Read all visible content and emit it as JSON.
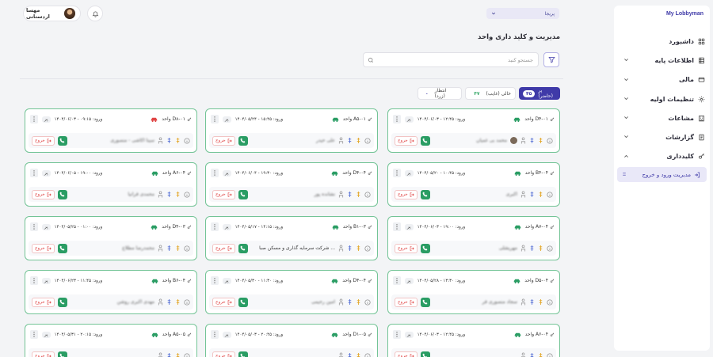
{
  "sidebar": {
    "brand": "My Lobbyman",
    "items": [
      {
        "label": "داشبورد",
        "icon": "dashboard-icon",
        "chevron": false
      },
      {
        "label": "اطلاعات پایه",
        "icon": "table-icon",
        "chevron": true
      },
      {
        "label": "مالی",
        "icon": "wallet-icon",
        "chevron": true
      },
      {
        "label": "تنظیمات اولیه",
        "icon": "gear-icon",
        "chevron": true
      },
      {
        "label": "مشاعات",
        "icon": "building-icon",
        "chevron": true
      },
      {
        "label": "گزارشات",
        "icon": "report-icon",
        "chevron": true
      },
      {
        "label": "کلیدداری",
        "icon": "key-icon",
        "chevron": true,
        "expanded": true
      }
    ],
    "subitem": {
      "label": "مدیریت ورود و خروج",
      "icon": "login-icon"
    }
  },
  "header": {
    "user_name": "مهسا اردستانی",
    "site_selector": "پریجا"
  },
  "main": {
    "title": "مدیریت و کلید داری واحد",
    "search_placeholder": "جستجو کنید",
    "tabs": {
      "full": {
        "label": "پر (حاضر)",
        "count": "۴۵"
      },
      "empty": {
        "label": "خالی (غایب)",
        "count": "۴۷"
      },
      "wait": {
        "label": "انتظار (زرد)",
        "count": "۰"
      }
    },
    "status_label": "پر",
    "exit_label": "خروج",
    "entry_prefix": "ورود:"
  },
  "cards": [
    {
      "unit": "واحد D۴-۰۱",
      "entry": "ورود: ۱۲:۴۵ - ۱۴۰۴/۰۶/۰۳",
      "person": "محمد بی غمیان",
      "blur": true,
      "avatar": true
    },
    {
      "unit": "واحد A۵-۰۱",
      "entry": "ورود: ۱۵:۴۵ - ۱۴۰۴/۰۵/۲۴",
      "person": "علی حیدر",
      "blur": true
    },
    {
      "unit": "واحد D۸-۰۱",
      "entry": "ورود: ۰۹:۱۵ - ۱۴۰۴/۰۶/۰۳",
      "person": "سینا اکاشی - منصوری",
      "blur": true,
      "redcar": true
    },
    {
      "unit": "واحد B۴-۰۴",
      "entry": "ورود: ۱۰:۴۵ - ۱۴۰۴/۰۵/۲۰",
      "person": "اکبری",
      "blur": true
    },
    {
      "unit": "واحد D۴-۰۴",
      "entry": "ورود: ۱۹:۳۰ - ۱۴۰۴/۰۶/۰۴",
      "person": "نشانده پور",
      "blur": true
    },
    {
      "unit": "واحد A۶-۰۴",
      "entry": "ورود: ۱۹:۰۰ - ۱۴۰۴/۰۶/۰۵",
      "person": "محمدی فرانیا",
      "blur": true
    },
    {
      "unit": "واحد A۷-۰۴",
      "entry": "ورود: ۱۹:۰۰ - ۱۴۰۴/۰۶/۰۳",
      "person": "مهریشلی",
      "blur": true
    },
    {
      "unit": "واحد B۱-۰۳",
      "entry": "ورود: ۱۴:۱۵ - ۱۴۰۴/۰۵/۱۷",
      "person": "شرکت سرمایه گذاری و مسکن صبا ...",
      "blur": false
    },
    {
      "unit": "واحد D۴-۰۳",
      "entry": "ورود: ۰۱:۰۰ - ۱۴۰۴/۰۵/۲۵",
      "person": "محمدرضا مطلاع",
      "blur": true
    },
    {
      "unit": "واحد D۵-۰۴",
      "entry": "ورود: ۱۳:۳۰ - ۱۴۰۴/۰۵/۲۸",
      "person": "سجاد منصوری فر",
      "blur": true
    },
    {
      "unit": "واحد D۴-۰۴",
      "entry": "ورود: ۱۱:۳۰ - ۱۴۰۴/۰۵/۳۰",
      "person": "امین رحیمی",
      "blur": true
    },
    {
      "unit": "واحد B۶-۰۴",
      "entry": "ورود: ۱۱:۴۵ - ۱۴۰۴/۰۶/۲۳",
      "person": "مهدی اکبری روشن",
      "blur": true
    },
    {
      "unit": "واحد A۶-۰۴",
      "entry": "ورود: ۱۲:۴۵ - ۱۴۰۴/۰۶/۰۳",
      "person": "",
      "blur": true
    },
    {
      "unit": "واحد D۱-۰۵",
      "entry": "ورود: ۲۰:۴۵ - ۱۴۰۴/۰۵/۰۳",
      "person": "",
      "blur": true
    },
    {
      "unit": "واحد A۵-۰۵",
      "entry": "ورود: ۲۰:۱۵ - ۱۴۰۴/۰۵/۳۱",
      "person": "",
      "blur": true
    }
  ],
  "colors": {
    "accent": "#3f3aa8",
    "card_border": "#73c496",
    "call": "#2a9d64",
    "exit": "#e04545"
  }
}
